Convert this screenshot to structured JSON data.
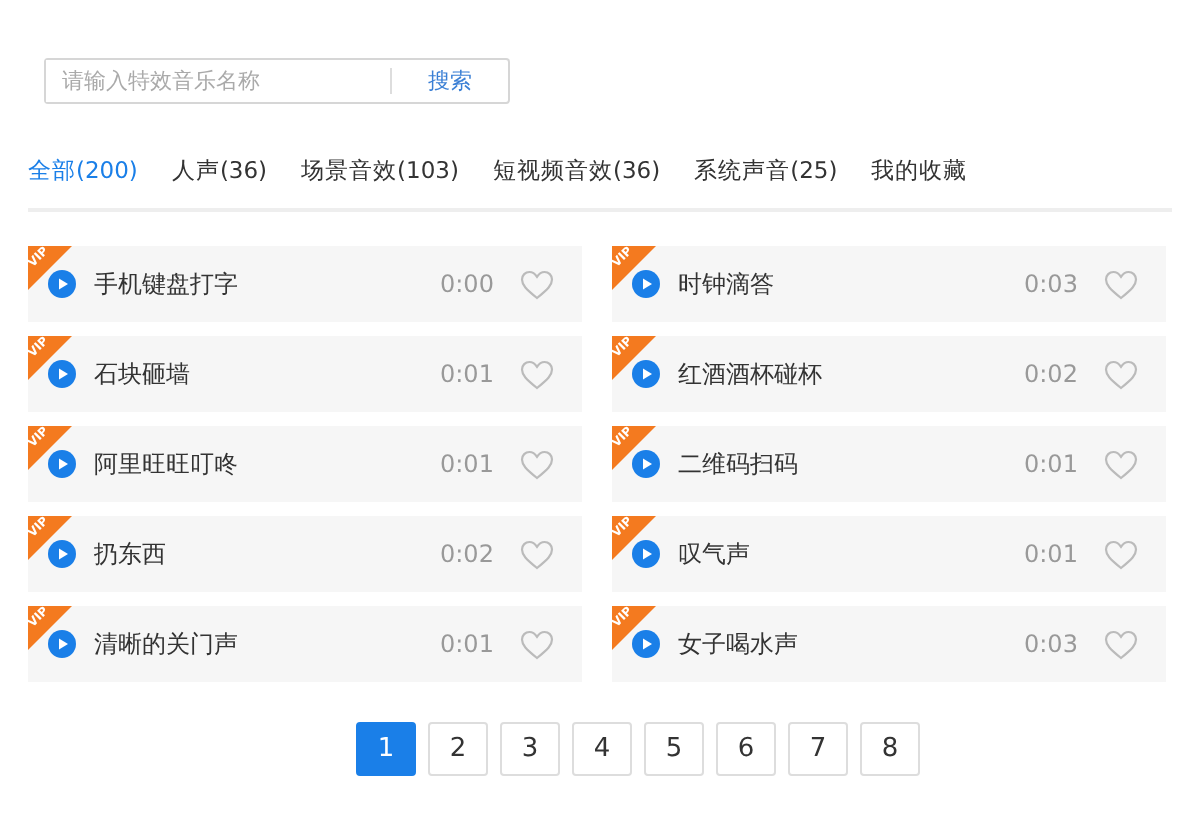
{
  "search": {
    "placeholder": "请输入特效音乐名称",
    "button": "搜索"
  },
  "tabs": [
    {
      "label": "全部(200)",
      "selected": true
    },
    {
      "label": "人声(36)",
      "selected": false
    },
    {
      "label": "场景音效(103)",
      "selected": false
    },
    {
      "label": "短视频音效(36)",
      "selected": false
    },
    {
      "label": "系统声音(25)",
      "selected": false
    },
    {
      "label": "我的收藏",
      "selected": false
    }
  ],
  "sounds": [
    {
      "badge": "VIP",
      "name": "手机键盘打字",
      "duration": "0:00",
      "favorite": false
    },
    {
      "badge": "VIP",
      "name": "时钟滴答",
      "duration": "0:03",
      "favorite": false
    },
    {
      "badge": "VIP",
      "name": "石块砸墙",
      "duration": "0:01",
      "favorite": false
    },
    {
      "badge": "VIP",
      "name": "红酒酒杯碰杯",
      "duration": "0:02",
      "favorite": false
    },
    {
      "badge": "VIP",
      "name": "阿里旺旺叮咚",
      "duration": "0:01",
      "favorite": false
    },
    {
      "badge": "VIP",
      "name": "二维码扫码",
      "duration": "0:01",
      "favorite": false
    },
    {
      "badge": "VIP",
      "name": "扔东西",
      "duration": "0:02",
      "favorite": false
    },
    {
      "badge": "VIP",
      "name": "叹气声",
      "duration": "0:01",
      "favorite": false
    },
    {
      "badge": "VIP",
      "name": "清晰的关门声",
      "duration": "0:01",
      "favorite": false
    },
    {
      "badge": "VIP",
      "name": "女子喝水声",
      "duration": "0:03",
      "favorite": false
    }
  ],
  "pages": [
    {
      "label": "1",
      "selected": true
    },
    {
      "label": "2",
      "selected": false
    },
    {
      "label": "3",
      "selected": false
    },
    {
      "label": "4",
      "selected": false
    },
    {
      "label": "5",
      "selected": false
    },
    {
      "label": "6",
      "selected": false
    },
    {
      "label": "7",
      "selected": false
    },
    {
      "label": "8",
      "selected": false
    }
  ]
}
